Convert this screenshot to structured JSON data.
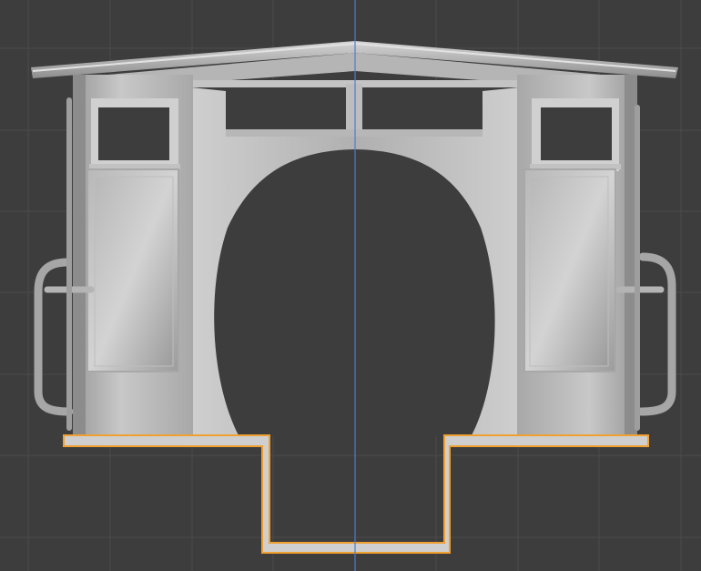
{
  "viewport": {
    "view": "front-orthographic",
    "background_color": "#3d3d3d",
    "grid_color": "#4a4a4a",
    "axis_color": "#4d7fc9",
    "selection_outline_color": "#f0a030"
  },
  "model": {
    "object": "cab-shell",
    "selected_part": "floor-step-profile",
    "selected": true
  }
}
